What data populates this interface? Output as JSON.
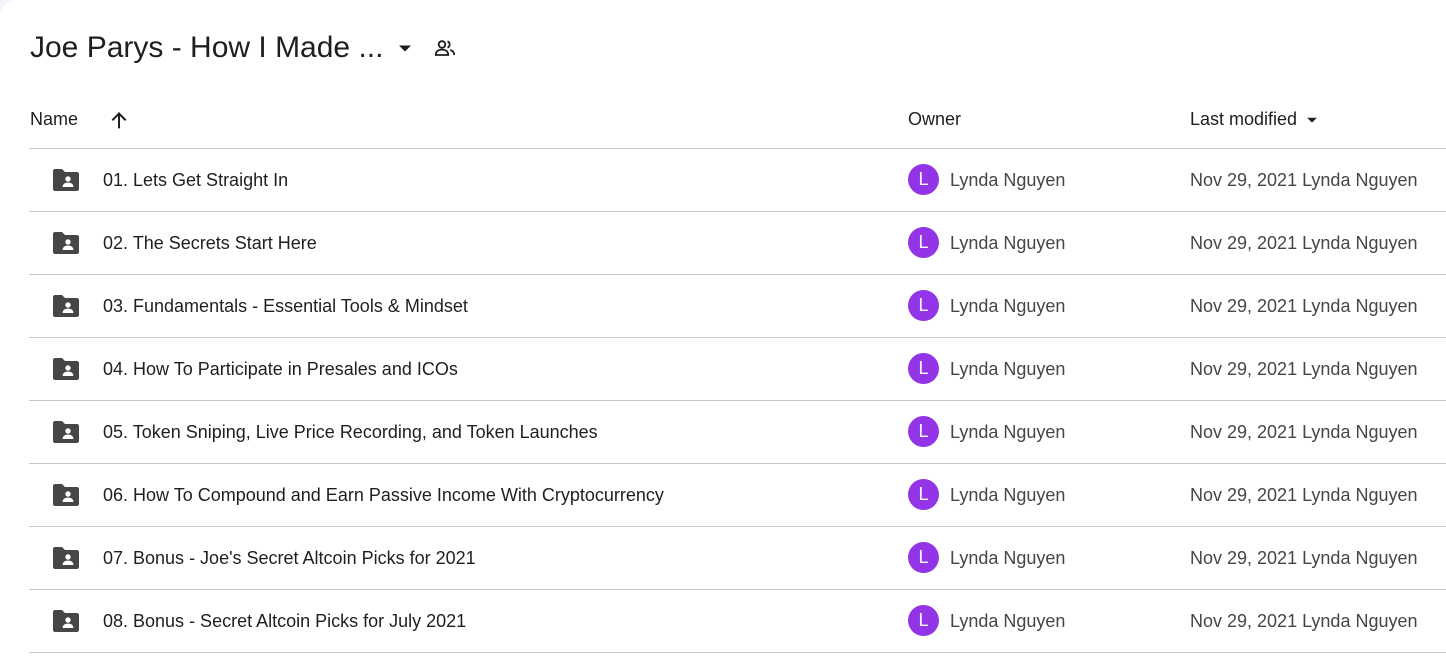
{
  "title": {
    "text": "Joe Parys - How I Made ...",
    "caret_icon": "arrow-drop-down-icon",
    "share_icon": "shared-people-icon"
  },
  "columns": {
    "name": "Name",
    "sort_icon": "arrow-upward-icon",
    "owner": "Owner",
    "last_modified": "Last modified",
    "last_modified_icon": "arrow-drop-down-icon"
  },
  "colors": {
    "avatar": "#9334e6",
    "folder_icon": "#444746",
    "divider": "#c7c7c7"
  },
  "files": [
    {
      "name": "01. Lets Get Straight In",
      "icon": "shared-folder-icon",
      "owner_initial": "L",
      "owner": "Lynda Nguyen",
      "modified": "Nov 29, 2021 Lynda Nguyen"
    },
    {
      "name": "02. The Secrets Start Here",
      "icon": "shared-folder-icon",
      "owner_initial": "L",
      "owner": "Lynda Nguyen",
      "modified": "Nov 29, 2021 Lynda Nguyen"
    },
    {
      "name": "03. Fundamentals - Essential Tools & Mindset",
      "icon": "shared-folder-icon",
      "owner_initial": "L",
      "owner": "Lynda Nguyen",
      "modified": "Nov 29, 2021 Lynda Nguyen"
    },
    {
      "name": "04. How To Participate in Presales and ICOs",
      "icon": "shared-folder-icon",
      "owner_initial": "L",
      "owner": "Lynda Nguyen",
      "modified": "Nov 29, 2021 Lynda Nguyen"
    },
    {
      "name": "05. Token Sniping, Live Price Recording, and Token Launches",
      "icon": "shared-folder-icon",
      "owner_initial": "L",
      "owner": "Lynda Nguyen",
      "modified": "Nov 29, 2021 Lynda Nguyen"
    },
    {
      "name": "06. How To Compound and Earn Passive Income With Cryptocurrency",
      "icon": "shared-folder-icon",
      "owner_initial": "L",
      "owner": "Lynda Nguyen",
      "modified": "Nov 29, 2021 Lynda Nguyen"
    },
    {
      "name": "07. Bonus - Joe's Secret Altcoin Picks for 2021",
      "icon": "shared-folder-icon",
      "owner_initial": "L",
      "owner": "Lynda Nguyen",
      "modified": "Nov 29, 2021 Lynda Nguyen"
    },
    {
      "name": "08. Bonus - Secret Altcoin Picks for July 2021",
      "icon": "shared-folder-icon",
      "owner_initial": "L",
      "owner": "Lynda Nguyen",
      "modified": "Nov 29, 2021 Lynda Nguyen"
    }
  ]
}
